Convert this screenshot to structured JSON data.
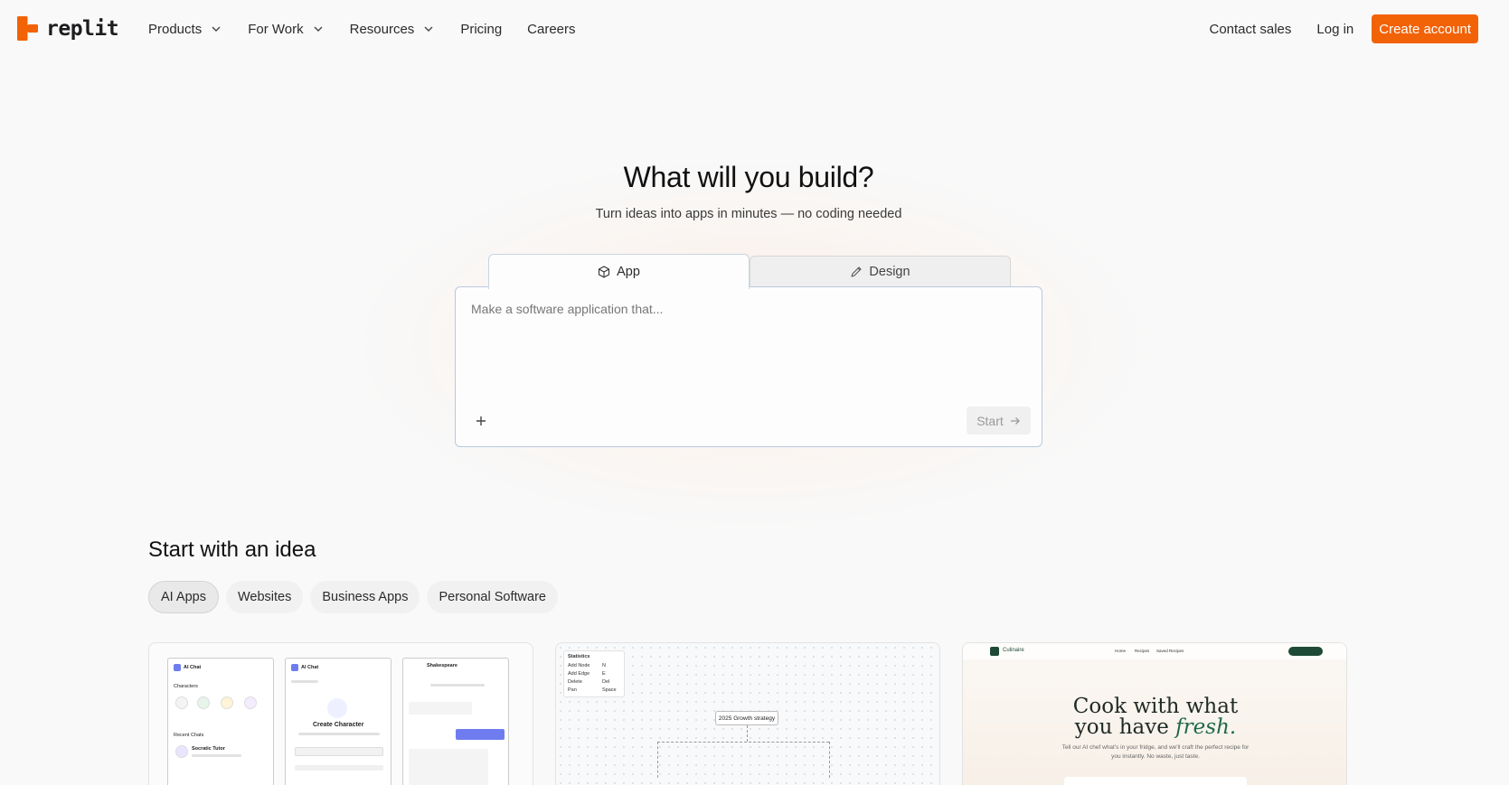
{
  "brand": {
    "name": "replit",
    "accent": "#f26207"
  },
  "nav": {
    "links": [
      {
        "label": "Products",
        "has_dropdown": true
      },
      {
        "label": "For Work",
        "has_dropdown": true
      },
      {
        "label": "Resources",
        "has_dropdown": true
      },
      {
        "label": "Pricing",
        "has_dropdown": false
      },
      {
        "label": "Careers",
        "has_dropdown": false
      }
    ],
    "contact_sales": "Contact sales",
    "login": "Log in",
    "create_account": "Create account"
  },
  "hero": {
    "title": "What will you build?",
    "subtitle": "Turn ideas into apps in minutes — no coding needed",
    "tabs": [
      {
        "label": "App",
        "icon": "cube-icon",
        "active": true
      },
      {
        "label": "Design",
        "icon": "pen-icon",
        "active": false
      }
    ],
    "prompt_placeholder": "Make a software application that...",
    "prompt_value": "",
    "start_label": "Start"
  },
  "ideas": {
    "title": "Start with an idea",
    "categories": [
      {
        "label": "AI Apps",
        "active": true
      },
      {
        "label": "Websites",
        "active": false
      },
      {
        "label": "Business Apps",
        "active": false
      },
      {
        "label": "Personal Software",
        "active": false
      }
    ],
    "cards": [
      {
        "screens": [
          {
            "title": "AI Chat",
            "section1": "Characters",
            "section2": "Recent Chats",
            "item": "Socratic Tutor"
          },
          {
            "title": "AI Chat",
            "heading": "Create Character"
          },
          {
            "title": "Shakespeare"
          }
        ]
      },
      {
        "stats": [
          {
            "label": "Statistics"
          },
          {
            "label": "Add Node",
            "value": "N"
          },
          {
            "label": "Add Edge",
            "value": "E"
          },
          {
            "label": "Delete",
            "value": "Del"
          },
          {
            "label": "Pan",
            "value": "Space"
          }
        ],
        "root_node": "2025 Growth strategy"
      },
      {
        "brand": "Culinaire",
        "links": [
          "Home",
          "Recipes",
          "Saved Recipes"
        ],
        "headline_line1": "Cook with what",
        "headline_line2_plain": "you have ",
        "headline_line2_emph": "fresh.",
        "subtext_line1": "Tell our AI chef what's in your fridge, and we'll craft the perfect recipe for",
        "subtext_line2": "you instantly. No waste, just taste."
      }
    ]
  }
}
